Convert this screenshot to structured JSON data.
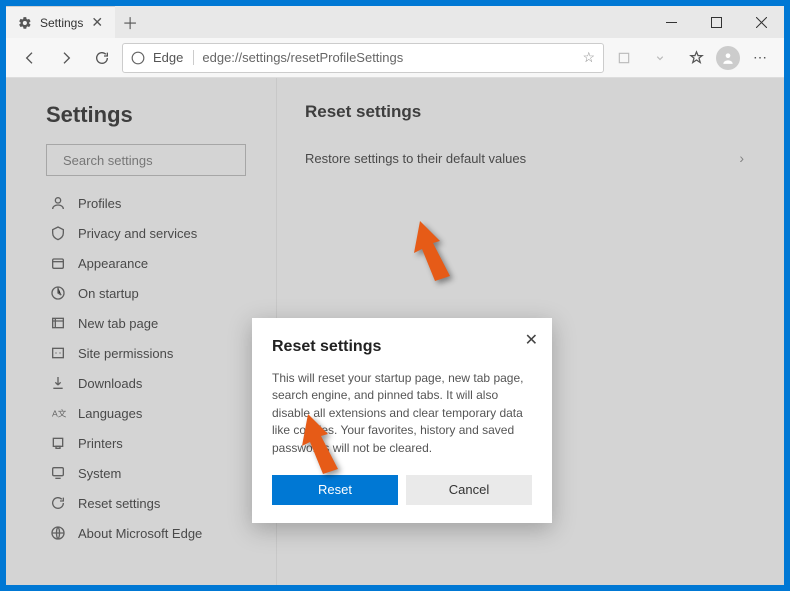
{
  "titlebar": {
    "tab_title": "Settings"
  },
  "addressbar": {
    "label": "Edge",
    "url": "edge://settings/resetProfileSettings"
  },
  "sidebar": {
    "heading": "Settings",
    "search_placeholder": "Search settings",
    "items": [
      {
        "label": "Profiles"
      },
      {
        "label": "Privacy and services"
      },
      {
        "label": "Appearance"
      },
      {
        "label": "On startup"
      },
      {
        "label": "New tab page"
      },
      {
        "label": "Site permissions"
      },
      {
        "label": "Downloads"
      },
      {
        "label": "Languages"
      },
      {
        "label": "Printers"
      },
      {
        "label": "System"
      },
      {
        "label": "Reset settings"
      },
      {
        "label": "About Microsoft Edge"
      }
    ]
  },
  "main": {
    "heading": "Reset settings",
    "row_label": "Restore settings to their default values"
  },
  "dialog": {
    "title": "Reset settings",
    "body": "This will reset your startup page, new tab page, search engine, and pinned tabs. It will also disable all extensions and clear temporary data like cookies. Your favorites, history and saved passwords will not be cleared.",
    "primary": "Reset",
    "secondary": "Cancel"
  }
}
